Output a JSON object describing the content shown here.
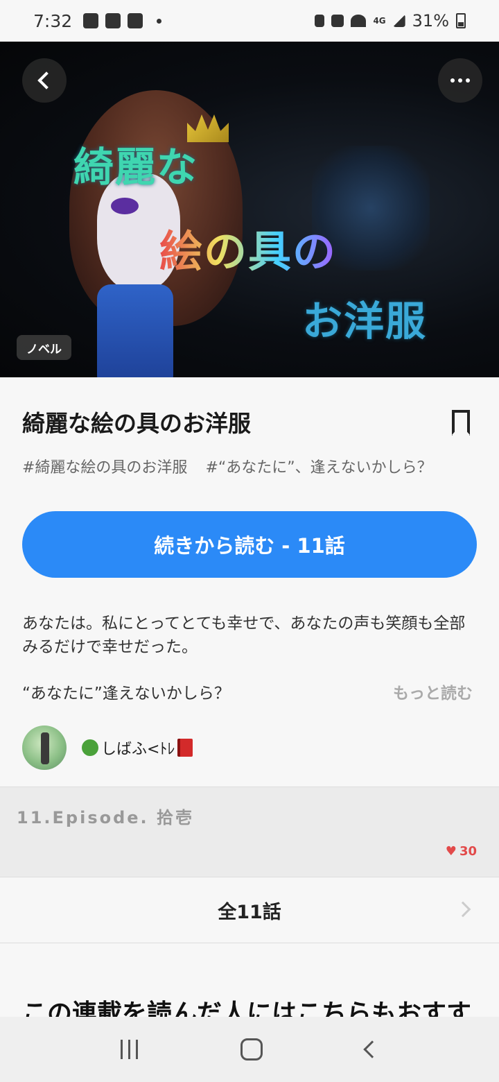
{
  "status_bar": {
    "time": "7:32",
    "battery": "31%",
    "network": "4G"
  },
  "hero": {
    "cover_title_line1": "綺麗な",
    "cover_title_line2": "絵の具の",
    "cover_title_line3": "お洋服",
    "tag": "ノベル"
  },
  "series": {
    "title": "綺麗な絵の具のお洋服",
    "hashtags": [
      "#綺麗な絵の具のお洋服",
      "#“あなたに”、逢えないかしら？"
    ],
    "read_button": "続きから読む - 11話",
    "description_1": "あなたは。私にとってとても幸せで、あなたの声も笑顔も全部みるだけで幸せだった。",
    "description_2": "“あなたに”逢えないかしら？",
    "more_link": "もっと読む",
    "author": "しばふ<ﾄﾚ"
  },
  "latest_episode": {
    "title": "11.Episode. 拾壱",
    "likes": "30"
  },
  "all_episodes": "全11話",
  "recommend_heading": "この連載を読んだ人にはこちらもおすす",
  "colors": {
    "accent": "#2b8af7",
    "like": "#e24a4a"
  }
}
